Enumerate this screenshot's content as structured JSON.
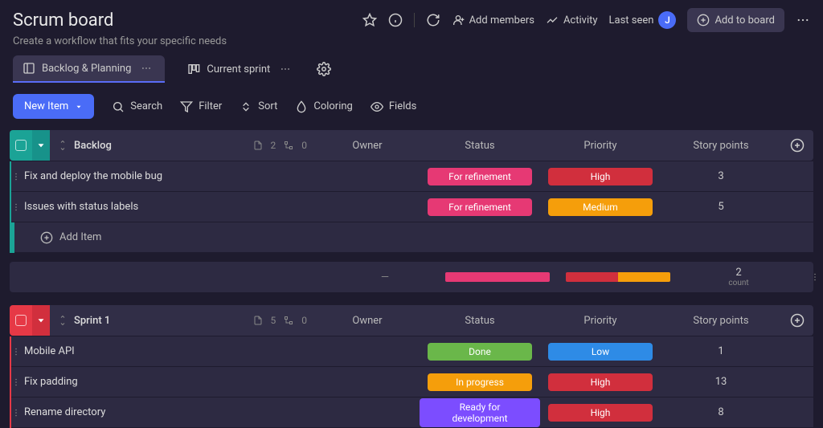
{
  "header": {
    "title": "Scrum board",
    "subtitle": "Create a workflow that fits your specific needs",
    "add_members": "Add members",
    "activity": "Activity",
    "last_seen": "Last seen",
    "avatar_initial": "J",
    "add_to_board": "Add to board"
  },
  "tabs": {
    "backlog": "Backlog & Planning",
    "sprint": "Current sprint"
  },
  "toolbar": {
    "new_item": "New Item",
    "search": "Search",
    "filter": "Filter",
    "sort": "Sort",
    "coloring": "Coloring",
    "fields": "Fields"
  },
  "columns": {
    "owner": "Owner",
    "status": "Status",
    "priority": "Priority",
    "points": "Story points"
  },
  "groups": {
    "backlog": {
      "name": "Backlog",
      "doc_count": "2",
      "sub_count": "0",
      "rows": [
        {
          "title": "Fix and deploy the mobile bug",
          "status": "For refinement",
          "priority": "High",
          "points": "3"
        },
        {
          "title": "Issues with status labels",
          "status": "For refinement",
          "priority": "Medium",
          "points": "5"
        }
      ],
      "add_item": "Add Item",
      "summary": {
        "owner_dash": "—",
        "count": "2",
        "count_label": "count"
      }
    },
    "sprint1": {
      "name": "Sprint 1",
      "doc_count": "5",
      "sub_count": "0",
      "rows": [
        {
          "title": "Mobile API",
          "status": "Done",
          "priority": "Low",
          "points": "1"
        },
        {
          "title": "Fix padding",
          "status": "In progress",
          "priority": "High",
          "points": "13"
        },
        {
          "title": "Rename directory",
          "status": "Ready for development",
          "priority": "High",
          "points": "8"
        }
      ]
    }
  }
}
